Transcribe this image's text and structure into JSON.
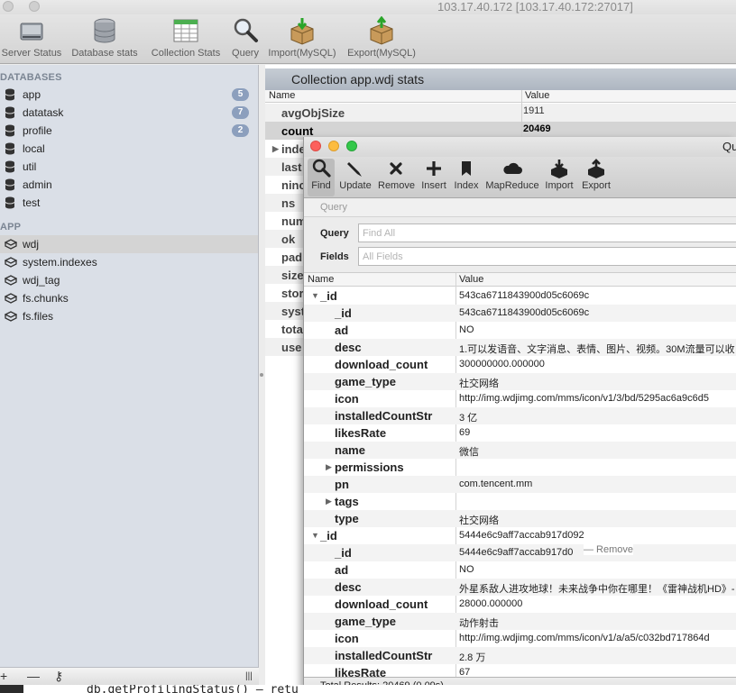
{
  "window": {
    "title": "103.17.40.172 [103.17.40.172:27017]"
  },
  "toolbar": {
    "server_status": "Server Status",
    "database_stats": "Database stats",
    "collection_stats": "Collection Stats",
    "query": "Query",
    "import_mysql": "Import(MySQL)",
    "export_mysql": "Export(MySQL)"
  },
  "sidebar": {
    "databases_header": "DATABASES",
    "databases": [
      {
        "label": "app",
        "badge": "5"
      },
      {
        "label": "datatask",
        "badge": "7"
      },
      {
        "label": "profile",
        "badge": "2"
      },
      {
        "label": "local"
      },
      {
        "label": "util"
      },
      {
        "label": "admin"
      },
      {
        "label": "test"
      }
    ],
    "collections_header": "APP",
    "collections": [
      {
        "label": "wdj"
      },
      {
        "label": "system.indexes"
      },
      {
        "label": "wdj_tag"
      },
      {
        "label": "fs.chunks"
      },
      {
        "label": "fs.files"
      }
    ],
    "bottom": {
      "add": "+",
      "remove": "—",
      "key": "⚷",
      "grip": "|||"
    }
  },
  "stats": {
    "title": "Collection app.wdj stats",
    "col_name": "Name",
    "col_value": "Value",
    "rows": [
      {
        "key": "avgObjSize",
        "value": "1911"
      },
      {
        "key": "count",
        "value": "20469"
      },
      {
        "key": "inde",
        "value": ""
      },
      {
        "key": "last",
        "value": ""
      },
      {
        "key": "ninc",
        "value": ""
      },
      {
        "key": "ns",
        "value": ""
      },
      {
        "key": "num",
        "value": ""
      },
      {
        "key": "ok",
        "value": ""
      },
      {
        "key": "pad",
        "value": ""
      },
      {
        "key": "size",
        "value": ""
      },
      {
        "key": "stor",
        "value": ""
      },
      {
        "key": "syst",
        "value": ""
      },
      {
        "key": "tota",
        "value": ""
      },
      {
        "key": "use",
        "value": ""
      }
    ]
  },
  "query_window": {
    "title": "Qu",
    "toolbar": {
      "find": "Find",
      "update": "Update",
      "remove": "Remove",
      "insert": "Insert",
      "index": "Index",
      "mapreduce": "MapReduce",
      "import": "Import",
      "export": "Export"
    },
    "section_label": "Query",
    "query_label": "Query",
    "query_placeholder": "Find All",
    "fields_label": "Fields",
    "fields_placeholder": "All Fields",
    "grid_col_name": "Name",
    "grid_col_value": "Value",
    "rows": [
      {
        "key": "_id",
        "value": "543ca6711843900d05c6069c",
        "toggle": "▼",
        "level": 0
      },
      {
        "key": "_id",
        "value": "543ca6711843900d05c6069c",
        "level": 1
      },
      {
        "key": "ad",
        "value": "NO",
        "level": 1
      },
      {
        "key": "desc",
        "value": "1.可以发语音、文字消息、表情、图片、视频。30M流量可以收",
        "level": 1
      },
      {
        "key": "download_count",
        "value": "300000000.000000",
        "level": 1
      },
      {
        "key": "game_type",
        "value": "社交网络",
        "level": 1
      },
      {
        "key": "icon",
        "value": "http://img.wdjimg.com/mms/icon/v1/3/bd/5295ac6a9c6d5",
        "level": 1
      },
      {
        "key": "installedCountStr",
        "value": "3 亿",
        "level": 1
      },
      {
        "key": "likesRate",
        "value": "69",
        "level": 1
      },
      {
        "key": "name",
        "value": "微信",
        "level": 1
      },
      {
        "key": "permissions",
        "value": "",
        "toggle": "▶",
        "level": 1
      },
      {
        "key": "pn",
        "value": "com.tencent.mm",
        "level": 1
      },
      {
        "key": "tags",
        "value": "",
        "toggle": "▶",
        "level": 1
      },
      {
        "key": "type",
        "value": "社交网络",
        "level": 1
      },
      {
        "key": "_id",
        "value": "5444e6c9aff7accab917d092",
        "toggle": "▼",
        "level": 0
      },
      {
        "key": "_id",
        "value": "5444e6c9aff7accab917d0",
        "level": 1
      },
      {
        "key": "ad",
        "value": "NO",
        "level": 1
      },
      {
        "key": "desc",
        "value": "外星系敌人进攻地球！未来战争中你在哪里！《雷神战机HD》-",
        "level": 1
      },
      {
        "key": "download_count",
        "value": "28000.000000",
        "level": 1
      },
      {
        "key": "game_type",
        "value": "动作射击",
        "level": 1
      },
      {
        "key": "icon",
        "value": "http://img.wdjimg.com/mms/icon/v1/a/a5/c032bd717864d",
        "level": 1
      },
      {
        "key": "installedCountStr",
        "value": "2.8 万",
        "level": 1
      },
      {
        "key": "likesRate",
        "value": "67",
        "level": 1
      }
    ],
    "hover_remove": "— Remove",
    "status": "Total Results: 20469 (0.09s)"
  },
  "console": {
    "text": "db.getProfilingStatus() – retu"
  },
  "colors": {
    "close": "#fc605c",
    "minimize": "#fdbc40",
    "zoom": "#34c84a",
    "badge": "#8c9fbd",
    "sidebar": "#dadfe7"
  }
}
